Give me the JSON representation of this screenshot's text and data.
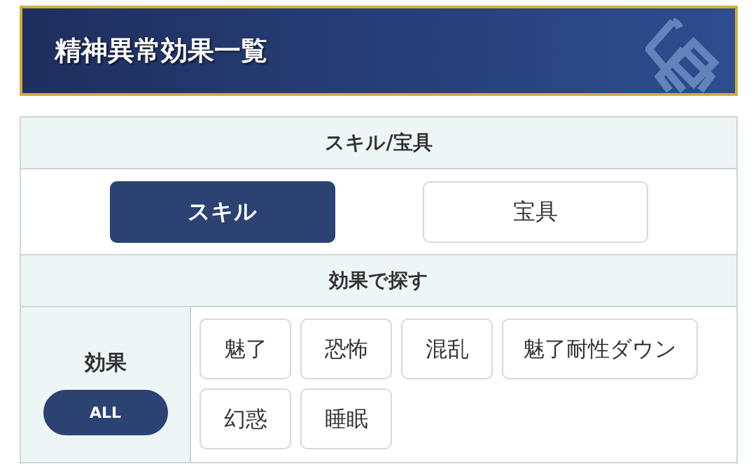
{
  "header": {
    "title": "精神異常効果一覧"
  },
  "type_filter": {
    "heading": "スキル/宝具",
    "options": [
      {
        "label": "スキル",
        "selected": true
      },
      {
        "label": "宝具",
        "selected": false
      }
    ]
  },
  "effect_filter": {
    "heading": "効果で探す",
    "row_label": "効果",
    "all_button": {
      "label": "ALL",
      "selected": true
    },
    "tags": [
      {
        "label": "魅了",
        "selected": false
      },
      {
        "label": "恐怖",
        "selected": false
      },
      {
        "label": "混乱",
        "selected": false
      },
      {
        "label": "魅了耐性ダウン",
        "selected": false
      },
      {
        "label": "幻惑",
        "selected": false
      },
      {
        "label": "睡眠",
        "selected": false
      }
    ]
  }
}
